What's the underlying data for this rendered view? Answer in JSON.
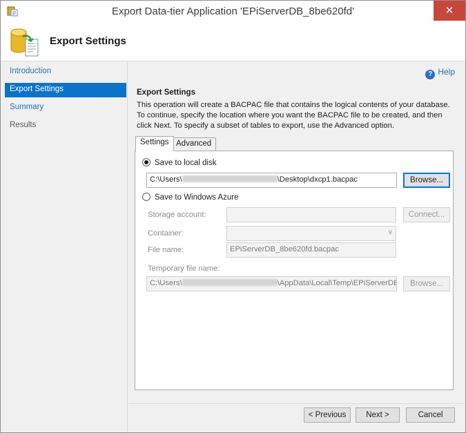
{
  "window": {
    "title": "Export Data-tier Application 'EPiServerDB_8be620fd'",
    "close_glyph": "✕"
  },
  "header": {
    "title": "Export Settings"
  },
  "sidebar": {
    "items": [
      {
        "label": "Introduction"
      },
      {
        "label": "Export Settings"
      },
      {
        "label": "Summary"
      },
      {
        "label": "Results"
      }
    ]
  },
  "help": {
    "label": "Help",
    "icon_glyph": "?"
  },
  "section": {
    "title": "Export Settings",
    "description": "This operation will create a BACPAC file that contains the logical contents of your database. To continue, specify the location where you want the BACPAC file to be created, and then click Next. To specify a subset of tables to export, use the Advanced option."
  },
  "tabs": [
    {
      "label": "Settings"
    },
    {
      "label": "Advanced"
    }
  ],
  "settings": {
    "local_disk": {
      "label": "Save to local disk",
      "path_prefix": "C:\\Users\\",
      "path_suffix": "\\Desktop\\dxcp1.bacpac",
      "browse_label": "Browse..."
    },
    "azure": {
      "label": "Save to Windows Azure",
      "storage_label": "Storage account:",
      "connect_label": "Connect...",
      "container_label": "Container:",
      "container_arrow": "∨",
      "file_label": "File name:",
      "file_value": "EPiServerDB_8be620fd.bacpac",
      "temp_label": "Temporary file name:",
      "temp_prefix": "C:\\Users\\",
      "temp_suffix": "\\AppData\\Local\\Temp\\EPiServerDB_",
      "temp_browse_label": "Browse..."
    }
  },
  "footer": {
    "previous_label": "< Previous",
    "next_label": "Next >",
    "cancel_label": "Cancel"
  }
}
